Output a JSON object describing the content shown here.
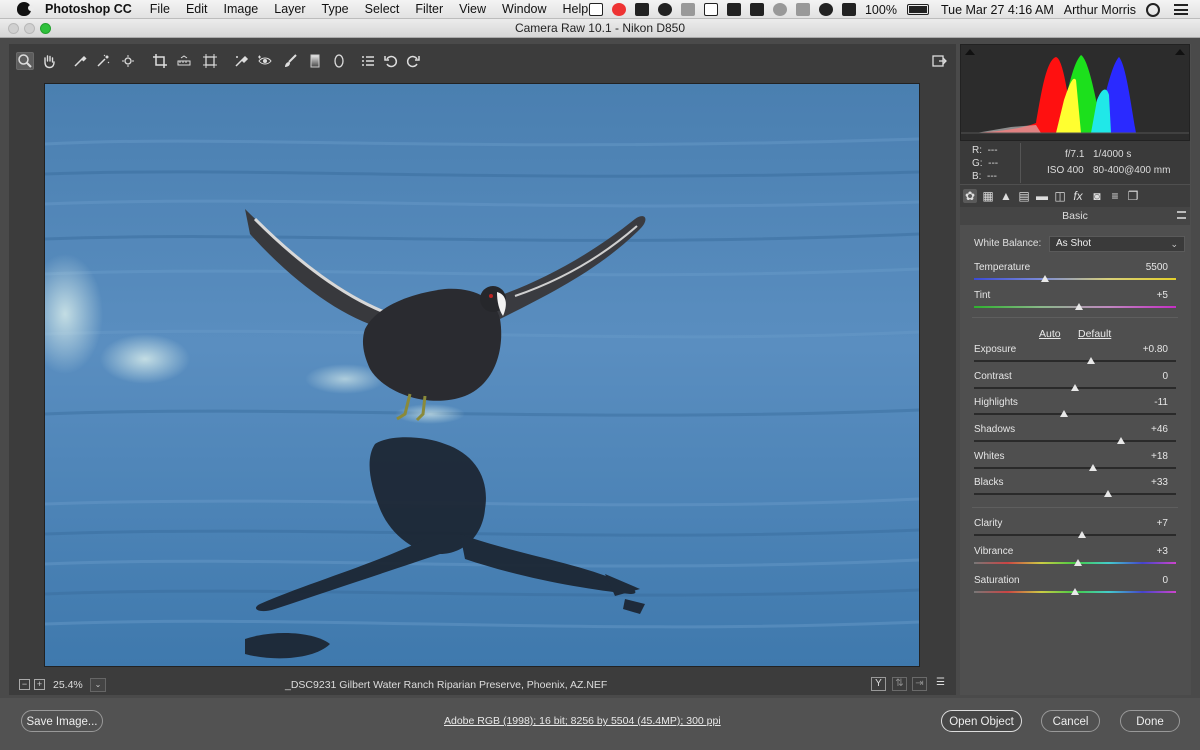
{
  "menubar": {
    "app_name": "Photoshop CC",
    "menus": [
      "File",
      "Edit",
      "Image",
      "Layer",
      "Type",
      "Select",
      "Filter",
      "View",
      "Window",
      "Help"
    ],
    "battery": "100%",
    "datetime": "Tue Mar 27  4:16 AM",
    "user": "Arthur Morris",
    "tray_icons": [
      "5",
      "",
      "",
      "",
      "",
      "C",
      "",
      "",
      "",
      "",
      "",
      "",
      "wifi",
      "volume"
    ]
  },
  "window": {
    "title": "Camera Raw 10.1  -  Nikon D850"
  },
  "toolbar": {
    "tools": [
      "zoom-tool",
      "hand-tool",
      "white-balance-tool",
      "color-sampler-tool",
      "targeted-adjustment-tool",
      "crop-tool",
      "straighten-tool",
      "transform-tool",
      "spot-removal-tool",
      "red-eye-tool",
      "adjustment-brush-tool",
      "graduated-filter-tool",
      "radial-filter-tool",
      "open-preferences",
      "rotate-left",
      "rotate-right"
    ]
  },
  "statusbar": {
    "zoom": "25.4%",
    "filename": "_DSC9231  Gilbert Water Ranch Riparian Preserve, Phoenix, AZ.NEF",
    "view_mode": "Y"
  },
  "info": {
    "r_label": "R:",
    "g_label": "G:",
    "b_label": "B:",
    "r_val": "---",
    "g_val": "---",
    "b_val": "---",
    "aperture": "f/7.1",
    "shutter": "1/4000 s",
    "iso": "ISO 400",
    "lens": "80-400@400 mm"
  },
  "panel": {
    "name": "Basic",
    "white_balance_label": "White Balance:",
    "white_balance_value": "As Shot",
    "auto_label": "Auto",
    "default_label": "Default",
    "sliders": [
      {
        "label": "Temperature",
        "value": "5500",
        "position": 0.35
      },
      {
        "label": "Tint",
        "value": "+5",
        "position": 0.52
      },
      {
        "label": "Exposure",
        "value": "+0.80",
        "position": 0.58
      },
      {
        "label": "Contrast",
        "value": "0",
        "position": 0.5
      },
      {
        "label": "Highlights",
        "value": "-11",
        "position": 0.445
      },
      {
        "label": "Shadows",
        "value": "+46",
        "position": 0.73
      },
      {
        "label": "Whites",
        "value": "+18",
        "position": 0.59
      },
      {
        "label": "Blacks",
        "value": "+33",
        "position": 0.665
      },
      {
        "label": "Clarity",
        "value": "+7",
        "position": 0.535
      },
      {
        "label": "Vibrance",
        "value": "+3",
        "position": 0.515
      },
      {
        "label": "Saturation",
        "value": "0",
        "position": 0.5
      }
    ]
  },
  "bottom": {
    "save_label": "Save Image...",
    "workflow": "Adobe RGB (1998); 16 bit; 8256 by 5504 (45.4MP); 300 ppi",
    "open_label": "Open Object",
    "cancel_label": "Cancel",
    "done_label": "Done"
  },
  "colors": {
    "panel_bg": "#4f4f4f",
    "canvas_bg": "#3c3c3c",
    "water": "#4f86b6"
  }
}
